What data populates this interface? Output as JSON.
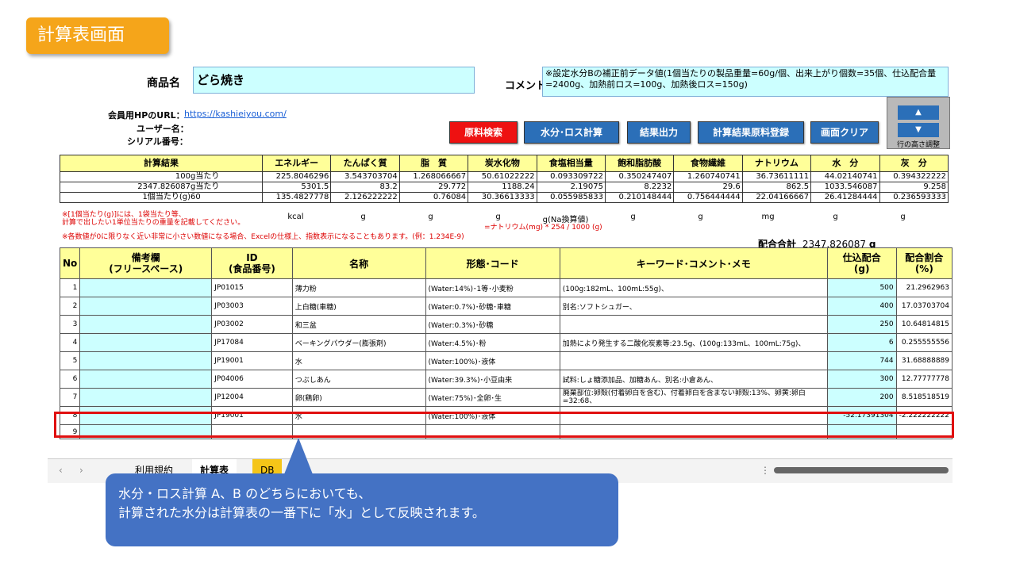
{
  "slide_title": "計算表画面",
  "product": {
    "label": "商品名",
    "value": "どら焼き"
  },
  "comment": {
    "label": "コメント",
    "value": "※設定水分Bの補正前データ値(1個当たりの製品重量=60g/個、出来上がり個数=35個、仕込配合量=2400g、加熱前ロス=100g、加熱後ロス=150g)"
  },
  "member": {
    "url_label": "会員用HPのURL：",
    "url": "https://kashieiyou.com/",
    "user_label": "ユーザー名：",
    "serial_label": "シリアル番号："
  },
  "buttons": {
    "search": "原料検索",
    "water": "水分･ロス計算",
    "output": "結果出力",
    "register": "計算結果原料登録",
    "clear": "画面クリア",
    "row_up": "▲",
    "row_down": "▼",
    "row_height": "行の高さ調整"
  },
  "results": {
    "header": [
      "計算結果",
      "エネルギー",
      "たんぱく質",
      "脂　質",
      "炭水化物",
      "食塩相当量",
      "飽和脂肪酸",
      "食物繊維",
      "ナトリウム",
      "水　分",
      "灰　分"
    ],
    "rows": [
      {
        "qty": "100",
        "unit": "g当たり",
        "values": [
          "225.8046296",
          "3.543703704",
          "1.268066667",
          "50.61022222",
          "0.093309722",
          "0.350247407",
          "1.260740741",
          "36.73611111",
          "44.02140741",
          "0.394322222"
        ]
      },
      {
        "qty": "2347.826087",
        "unit": "g当たり",
        "values": [
          "5301.5",
          "83.2",
          "29.772",
          "1188.24",
          "2.19075",
          "8.2232",
          "29.6",
          "862.5",
          "1033.546087",
          "9.258"
        ]
      },
      {
        "qty": "1個当たり(g)",
        "unit": "60",
        "values": [
          "135.4827778",
          "2.126222222",
          "0.76084",
          "30.36613333",
          "0.055985833",
          "0.210148444",
          "0.756444444",
          "22.04166667",
          "26.41284444",
          "0.236593333"
        ]
      }
    ],
    "units": [
      "kcal",
      "g",
      "g",
      "g",
      "g(Na換算値)",
      "g",
      "g",
      "mg",
      "g",
      "g"
    ],
    "sodium_note": "=ナトリウム(mg) * 254 / 1000 (g)"
  },
  "notes": [
    "※[1個当たり(g)]には、1袋当たり等、",
    "計算で出したい1単位当たりの重量を記載してください。",
    "※各数値が0に限りなく近い非常に小さい数値になる場合、Excelの仕様上、指数表示になることもあります。(例：1.234E-9)"
  ],
  "total": {
    "label": "配合合計",
    "value": "2347.826087",
    "unit": "g"
  },
  "table": {
    "headers": [
      "No",
      "備考欄\n(フリースペース)",
      "ID\n(食品番号)",
      "名称",
      "形態･コード",
      "キーワード･コメント･メモ",
      "仕込配合\n(g)",
      "配合割合\n(%)"
    ],
    "rows": [
      {
        "no": "1",
        "id": "JP01015",
        "name": "薄力粉",
        "form": "(Water:14%)･1等･小麦粉",
        "memo": "(100g:182mL、100mL:55g)、",
        "amount": "500",
        "ratio": "21.2962963"
      },
      {
        "no": "2",
        "id": "JP03003",
        "name": "上白糖(車糖)",
        "form": "(Water:0.7%)･砂糖･車糖",
        "memo": "別名:ソフトシュガー、",
        "amount": "400",
        "ratio": "17.03703704"
      },
      {
        "no": "3",
        "id": "JP03002",
        "name": "和三盆",
        "form": "(Water:0.3%)･砂糖",
        "memo": "",
        "amount": "250",
        "ratio": "10.64814815"
      },
      {
        "no": "4",
        "id": "JP17084",
        "name": "ベーキングパウダー(膨張剤)",
        "form": "(Water:4.5%)･粉",
        "memo": "加熱により発生する二酸化炭素等:23.5g、(100g:133mL、100mL:75g)、",
        "amount": "6",
        "ratio": "0.255555556"
      },
      {
        "no": "5",
        "id": "JP19001",
        "name": "水",
        "form": "(Water:100%)･液体",
        "memo": "",
        "amount": "744",
        "ratio": "31.68888889"
      },
      {
        "no": "6",
        "id": "JP04006",
        "name": "つぶしあん",
        "form": "(Water:39.3%)･小豆由来",
        "memo": "試料:しょ糖添加品、加糖あん、別名:小倉あん、",
        "amount": "300",
        "ratio": "12.77777778"
      },
      {
        "no": "7",
        "id": "JP12004",
        "name": "卵(鶏卵)",
        "form": "(Water:75%)･全卵･生",
        "memo": "廃棄部位:卵殻(付着卵白を含む)、付着卵白を含まない卵殻:13%、卵黄:卵白=32:68、",
        "amount": "200",
        "ratio": "8.518518519"
      },
      {
        "no": "8",
        "id": "JP19001",
        "name": "水",
        "form": "(Water:100%)･液体",
        "memo": "",
        "amount": "-52.17391304",
        "ratio": "-2.222222222"
      },
      {
        "no": "9",
        "id": "",
        "name": "",
        "form": "",
        "memo": "",
        "amount": "",
        "ratio": ""
      }
    ]
  },
  "sheet_tabs": [
    "利用規約",
    "計算表",
    "DB"
  ],
  "callout": {
    "line1": "水分・ロス計算 A、B のどちらにおいても、",
    "line2": "計算された水分は計算表の一番下に「水」として反映されます。"
  }
}
